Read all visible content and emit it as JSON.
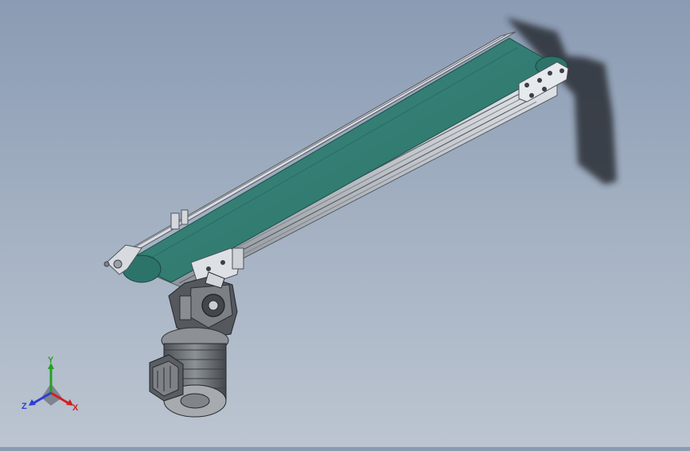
{
  "viewport": {
    "background_top": "#8a9bb3",
    "background_bottom": "#bcc5d1"
  },
  "model": {
    "belt_color": "#2f7a70",
    "frame_color": "#c8ccd3",
    "motor_color": "#6d7276"
  },
  "triad": {
    "x_label": "X",
    "y_label": "Y",
    "z_label": "Z",
    "x_color": "#d22020",
    "y_color": "#25a025",
    "z_color": "#2b3fd0"
  }
}
